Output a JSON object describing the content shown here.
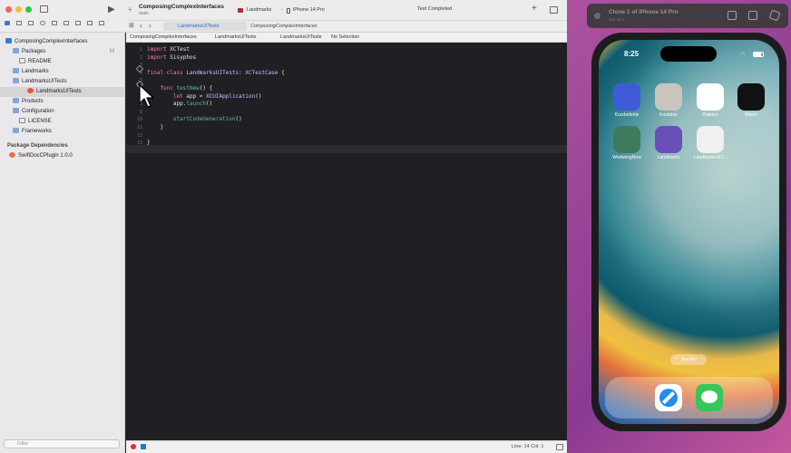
{
  "toolbar": {
    "project_name": "ComposingComplexInterfaces",
    "branch": "main",
    "scheme": "Landmarks",
    "device": "iPhone 14 Pro",
    "status": "Test Completed"
  },
  "tabs": [
    {
      "label": "LandmarksUITests"
    },
    {
      "label": "ComposingComplexInterfaces"
    }
  ],
  "jumpbar": {
    "items": [
      "ComposingComplexInterfaces",
      "LandmarksUITests",
      "LandmarksUITests",
      "No Selection"
    ]
  },
  "navigator": {
    "root": "ComposingComplexInterfaces",
    "items": [
      {
        "label": "Packages",
        "badge": "M"
      },
      {
        "label": "README"
      },
      {
        "label": "Landmarks"
      },
      {
        "label": "LandmarksUITests"
      },
      {
        "label": "LandmarksUITests"
      },
      {
        "label": "Products"
      },
      {
        "label": "Configuration"
      },
      {
        "label": "LICENSE"
      },
      {
        "label": "Frameworks"
      }
    ],
    "dependencies_header": "Package Dependencies",
    "dependency": "SwiftDocCPlugin 1.0.0",
    "filter_placeholder": "Filter"
  },
  "code": {
    "lines": [
      {
        "n": "1",
        "parts": [
          {
            "t": "import",
            "c": "kw"
          },
          {
            "t": " XCTest",
            "c": "pl"
          }
        ]
      },
      {
        "n": "2",
        "parts": [
          {
            "t": "import",
            "c": "kw"
          },
          {
            "t": " Sisyphos",
            "c": "pl"
          }
        ]
      },
      {
        "n": "3",
        "parts": []
      },
      {
        "n": "4",
        "parts": [
          {
            "t": "final class",
            "c": "kw"
          },
          {
            "t": " LandmarksUITests",
            "c": "ty"
          },
          {
            "t": ": ",
            "c": "pl"
          },
          {
            "t": "XCTestCase",
            "c": "ty"
          },
          {
            "t": " {",
            "c": "pl"
          }
        ]
      },
      {
        "n": "5",
        "parts": []
      },
      {
        "n": "6",
        "parts": [
          {
            "t": "    func",
            "c": "kw"
          },
          {
            "t": " testNew",
            "c": "fn"
          },
          {
            "t": "() {",
            "c": "pl"
          }
        ]
      },
      {
        "n": "7",
        "parts": [
          {
            "t": "        let",
            "c": "kw"
          },
          {
            "t": " app = ",
            "c": "pl"
          },
          {
            "t": "XCUIApplication",
            "c": "ty"
          },
          {
            "t": "()",
            "c": "pl"
          }
        ]
      },
      {
        "n": "8",
        "parts": [
          {
            "t": "        app.",
            "c": "pl"
          },
          {
            "t": "launch",
            "c": "fn"
          },
          {
            "t": "()",
            "c": "pl"
          }
        ]
      },
      {
        "n": "9",
        "parts": []
      },
      {
        "n": "10",
        "parts": [
          {
            "t": "        startCodeGeneration",
            "c": "fn"
          },
          {
            "t": "()",
            "c": "pl"
          }
        ]
      },
      {
        "n": "11",
        "parts": [
          {
            "t": "    }",
            "c": "pl"
          }
        ]
      },
      {
        "n": "12",
        "parts": []
      },
      {
        "n": "13",
        "parts": [
          {
            "t": "}",
            "c": "pl"
          }
        ]
      },
      {
        "n": "14",
        "parts": []
      }
    ]
  },
  "statusbar": {
    "position": "Line: 14  Col: 1"
  },
  "simulator": {
    "title": "Clone 1 of iPhone 14 Pro",
    "subtitle": "iOS 16.1",
    "time": "8:25",
    "apps": [
      {
        "label": "Kurzbefehle",
        "color": "#3f5bd6"
      },
      {
        "label": "Kontakte",
        "color": "#c9c4be"
      },
      {
        "label": "Dateien",
        "color": "#ffffff"
      },
      {
        "label": "Watch",
        "color": "#111111"
      },
      {
        "label": "WestwingNow",
        "color": "#3e7a5e"
      },
      {
        "label": "Landmarks",
        "color": "#6a4fb8"
      },
      {
        "label": "LandmarksUIT...",
        "color": "#f0f0f0"
      }
    ],
    "search_label": "Suchen",
    "dock": [
      {
        "name": "safari",
        "color": "#ffffff"
      },
      {
        "name": "messages",
        "color": "#35c759"
      }
    ]
  }
}
